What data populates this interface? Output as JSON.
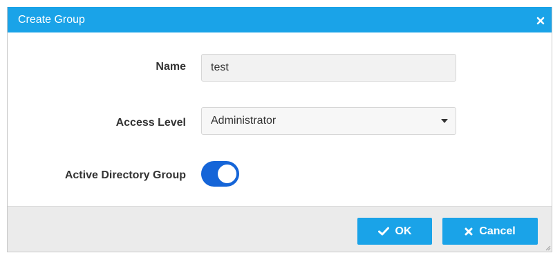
{
  "dialog": {
    "title": "Create Group",
    "close_icon": "close-icon"
  },
  "form": {
    "name_label": "Name",
    "name_value": "test",
    "access_level_label": "Access Level",
    "access_level_value": "Administrator",
    "active_directory_label": "Active Directory Group",
    "active_directory_enabled": true
  },
  "footer": {
    "ok_label": "OK",
    "ok_icon": "check-icon",
    "cancel_label": "Cancel",
    "cancel_icon": "close-icon"
  },
  "colors": {
    "header": "#1aa3e8",
    "button": "#1aa3e8",
    "toggle_on": "#1565d8",
    "footer_bg": "#ebebeb"
  }
}
